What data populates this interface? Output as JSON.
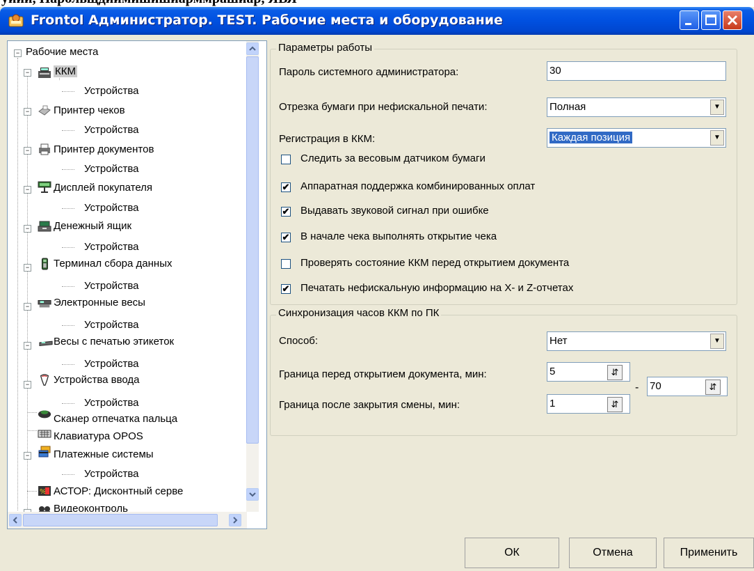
{
  "caption": "уиии, Парольщдиимишишиарммрашиар, ЯВЯ",
  "window": {
    "title": "Frontol Администратор. TEST.  Рабочие места и оборудование"
  },
  "tree": {
    "items": [
      {
        "label": "Рабочие места",
        "icon": "none"
      },
      {
        "label": "ККМ",
        "icon": "cash-register-icon"
      },
      {
        "label": "Устройства",
        "icon": "none"
      },
      {
        "label": "Принтер чеков",
        "icon": "receipt-printer-icon"
      },
      {
        "label": "Устройства",
        "icon": "none"
      },
      {
        "label": "Принтер документов",
        "icon": "document-printer-icon"
      },
      {
        "label": "Устройства",
        "icon": "none"
      },
      {
        "label": "Дисплей покупателя",
        "icon": "customer-display-icon"
      },
      {
        "label": "Устройства",
        "icon": "none"
      },
      {
        "label": "Денежный ящик",
        "icon": "cash-drawer-icon"
      },
      {
        "label": "Устройства",
        "icon": "none"
      },
      {
        "label": "Терминал сбора данных",
        "icon": "data-terminal-icon"
      },
      {
        "label": "Устройства",
        "icon": "none"
      },
      {
        "label": "Электронные весы",
        "icon": "scales-icon"
      },
      {
        "label": "Устройства",
        "icon": "none"
      },
      {
        "label": "Весы с печатью этикеток",
        "icon": "label-scales-icon"
      },
      {
        "label": "Устройства",
        "icon": "none"
      },
      {
        "label": "Устройства ввода",
        "icon": "input-device-icon"
      },
      {
        "label": "Устройства",
        "icon": "none"
      },
      {
        "label": "Сканер отпечатка пальца",
        "icon": "fingerprint-scanner-icon"
      },
      {
        "label": "Клавиатура OPOS",
        "icon": "keyboard-icon"
      },
      {
        "label": "Платежные системы",
        "icon": "payment-systems-icon"
      },
      {
        "label": "Устройства",
        "icon": "none"
      },
      {
        "label": "АСТОР: Дисконтный серве",
        "icon": "discount-server-icon"
      },
      {
        "label": "Видеоконтроль",
        "icon": "video-control-icon"
      }
    ]
  },
  "work_params": {
    "legend": "Параметры работы",
    "admin_password_label": "Пароль системного администратора:",
    "admin_password_value": "30",
    "paper_cut_label": "Отрезка бумаги при нефискальной печати:",
    "paper_cut_value": "Полная",
    "registration_label": "Регистрация в ККМ:",
    "registration_value": "Каждая позиция",
    "checkboxes": [
      {
        "label": "Следить за весовым датчиком бумаги",
        "checked": false
      },
      {
        "label": "Аппаратная поддержка комбинированных оплат",
        "checked": true
      },
      {
        "label": "Выдавать звуковой сигнал при ошибке",
        "checked": true
      },
      {
        "label": "В начале чека выполнять открытие чека",
        "checked": true
      },
      {
        "label": "Проверять состояние ККМ перед открытием документа",
        "checked": false
      },
      {
        "label": "Печатать нефискальную информацию на X- и Z-отчетах",
        "checked": true
      }
    ]
  },
  "clock_sync": {
    "legend": "Синхронизация часов ККМ по ПК",
    "method_label": "Способ:",
    "method_value": "Нет",
    "before_open_label": "Граница перед открытием документа, мин:",
    "before_open_value": "5",
    "dash": "-",
    "range_value": "70",
    "after_close_label": "Граница после закрытия смены, мин:",
    "after_close_value": "1"
  },
  "buttons": {
    "ok": "ОК",
    "cancel": "Отмена",
    "apply": "Применить"
  },
  "colors": {
    "titlebar": "#0050e0",
    "selection": "#316ac5",
    "dialog_bg": "#ece9d8"
  }
}
